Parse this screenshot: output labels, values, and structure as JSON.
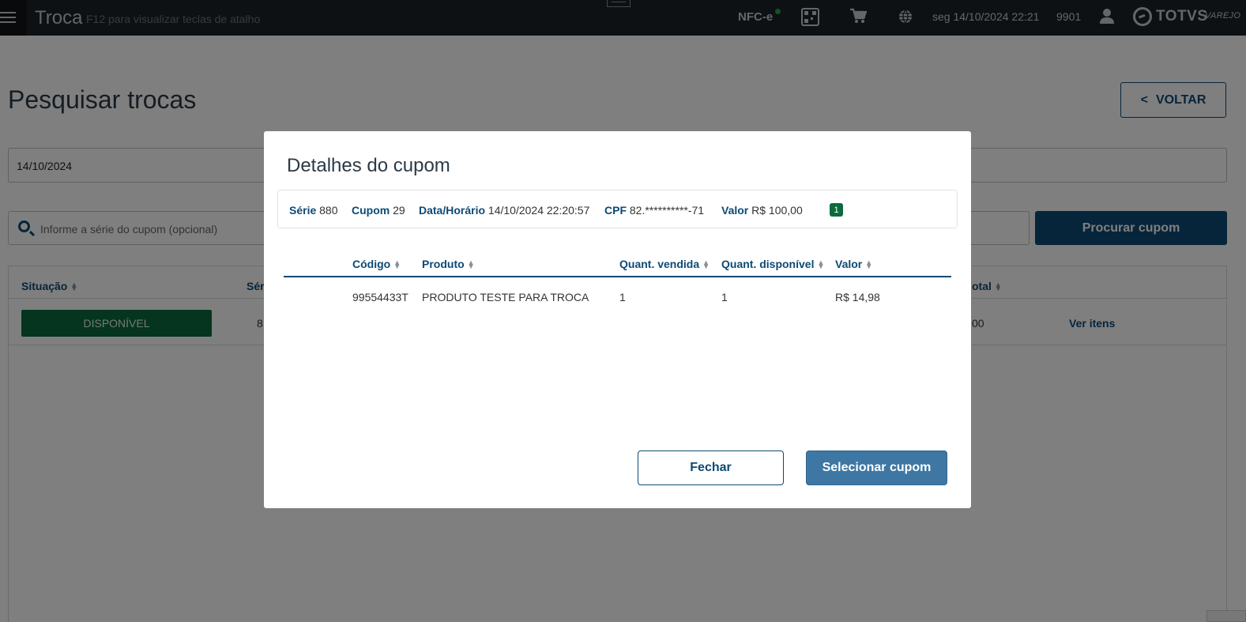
{
  "topbar": {
    "app_title": "Troca",
    "hint": "F12 para visualizar teclas de atalho",
    "nfce_label": "NFC-e",
    "nfce_status_color": "#1aa64b",
    "datetime": "seg 14/10/2024 22:21",
    "user_code": "9901",
    "logo_text": "TOTVS",
    "logo_subtext": "VAREJO",
    "icons": [
      "menu-icon",
      "qr-code-icon",
      "cart-icon",
      "globe-icon",
      "user-icon",
      "totvs-logo"
    ]
  },
  "page": {
    "title": "Pesquisar trocas",
    "back_label": "VOLTAR",
    "back_icon": "<",
    "date_value": "14/10/2024",
    "search_placeholder": "Informe a série do cupom (opcional)",
    "search_button": "Procurar cupom",
    "table_headers": [
      "Situação",
      "Sér",
      "otal"
    ],
    "row": {
      "status": "DISPONÍVEL",
      "serie_partial": "8",
      "total_partial": "00",
      "action": "Ver itens"
    }
  },
  "modal": {
    "title": "Detalhes do cupom",
    "info": {
      "serie_label": "Série",
      "serie_value": "880",
      "cupom_label": "Cupom",
      "cupom_value": "29",
      "datahora_label": "Data/Horário",
      "datahora_value": "14/10/2024 22:20:57",
      "cpf_label": "CPF",
      "cpf_value": "82.**********-71",
      "valor_label": "Valor",
      "valor_value": "R$ 100,00",
      "items_count": "1"
    },
    "columns": [
      "Código",
      "Produto",
      "Quant. vendida",
      "Quant. disponível",
      "Valor"
    ],
    "items": [
      {
        "codigo": "99554433T",
        "produto": "PRODUTO TESTE PARA TROCA",
        "qtd_vendida": "1",
        "qtd_disponivel": "1",
        "valor": "R$ 14,98"
      }
    ],
    "close_button": "Fechar",
    "select_button": "Selecionar cupom"
  },
  "colors": {
    "primary": "#0c4a74",
    "success": "#0a6b3d",
    "topbar": "#1d2226",
    "select_button": "#3e77a3"
  }
}
